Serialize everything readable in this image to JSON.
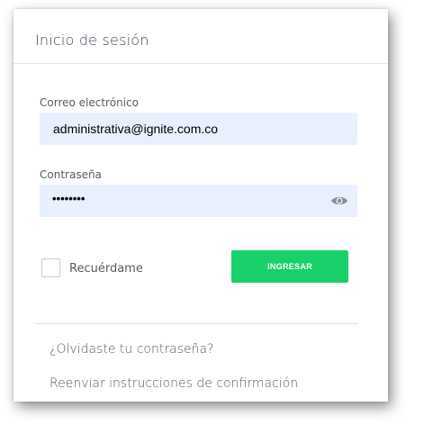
{
  "login_card": {
    "title": "Inicio de sesión",
    "email": {
      "label": "Correo electrónico",
      "value": "administrativa@ignite.com.co"
    },
    "password": {
      "label": "Contraseña",
      "masked_value": "••••••••",
      "toggle_icon": "eye-icon"
    },
    "remember": {
      "label": "Recuérdame",
      "checked": false
    },
    "submit_label": "INGRESAR",
    "links": {
      "forgot_password": "¿Olvidaste tu contraseña?",
      "resend_confirmation": "Reenviar instrucciones de confirmación"
    }
  },
  "colors": {
    "input_background": "#e8f0fe",
    "submit_button": "#19d06a",
    "text": "#555d66",
    "divider": "#dde1e5"
  }
}
